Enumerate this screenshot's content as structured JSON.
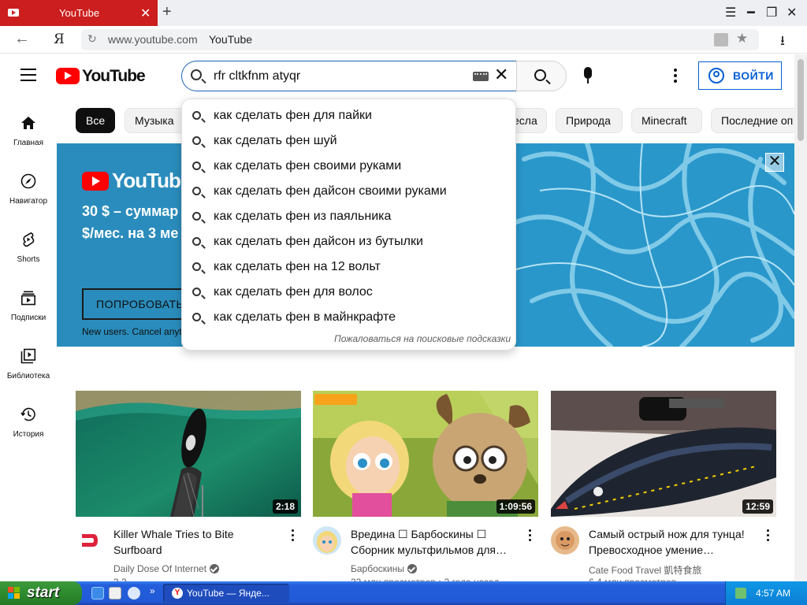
{
  "browser": {
    "tab_title": "YouTube",
    "new_tab": "+",
    "url": "www.youtube.com",
    "page_title": "YouTube",
    "ya_label": "Я"
  },
  "header": {
    "logo_text": "YouTube",
    "search_value": "rfr cltkfnm atyqr",
    "signin_label": "ВОЙТИ"
  },
  "nav": [
    {
      "label": "Главная",
      "icon": "home-icon"
    },
    {
      "label": "Навигатор",
      "icon": "compass-icon"
    },
    {
      "label": "Shorts",
      "icon": "shorts-icon"
    },
    {
      "label": "Подписки",
      "icon": "subscriptions-icon"
    },
    {
      "label": "Библиотека",
      "icon": "library-icon"
    },
    {
      "label": "История",
      "icon": "history-icon"
    }
  ],
  "chips": [
    "Все",
    "Музыка",
    "есла",
    "Природа",
    "Minecraft",
    "Последние оп"
  ],
  "banner": {
    "logo_text": "YouTubeTV",
    "line1": "30 $ – суммар",
    "line2": "$/мес. на 3 ме",
    "button": "ПОПРОБОВАТЬ",
    "note": "New users. Cancel anyt",
    "close": "✕"
  },
  "suggestions": [
    "как сделать фен для пайки",
    "как сделать фен шуй",
    "как сделать фен своими руками",
    "как сделать фен дайсон своими руками",
    "как сделать фен из паяльника",
    "как сделать фен дайсон из бутылки",
    "как сделать фен на 12 вольт",
    "как сделать фен для волос",
    "как сделать фен в майнкрафте"
  ],
  "report_suggestions": "Пожаловаться на поисковые подсказки",
  "videos": [
    {
      "title": "Killer Whale Tries to Bite Surfboard",
      "channel": "Daily Dose Of Internet",
      "verified": true,
      "duration": "2:18",
      "meta": "3,2"
    },
    {
      "title": "Вредина ☐ Барбоскины ☐ Сборник мультфильмов для…",
      "channel": "Барбоскины",
      "verified": true,
      "duration": "1:09:56",
      "meta": "22 млн просмотров • 2 года назад"
    },
    {
      "title": "Самый острый нож для тунца! Превосходное умение…",
      "channel": "Cate Food Travel 凱特食旅",
      "verified": false,
      "duration": "12:59",
      "meta": "6,4 млн просмотров"
    }
  ],
  "taskbar": {
    "start_label": "start",
    "task_label": "YouTube — Янде...",
    "time": "4:57 AM",
    "overflow": "»"
  }
}
